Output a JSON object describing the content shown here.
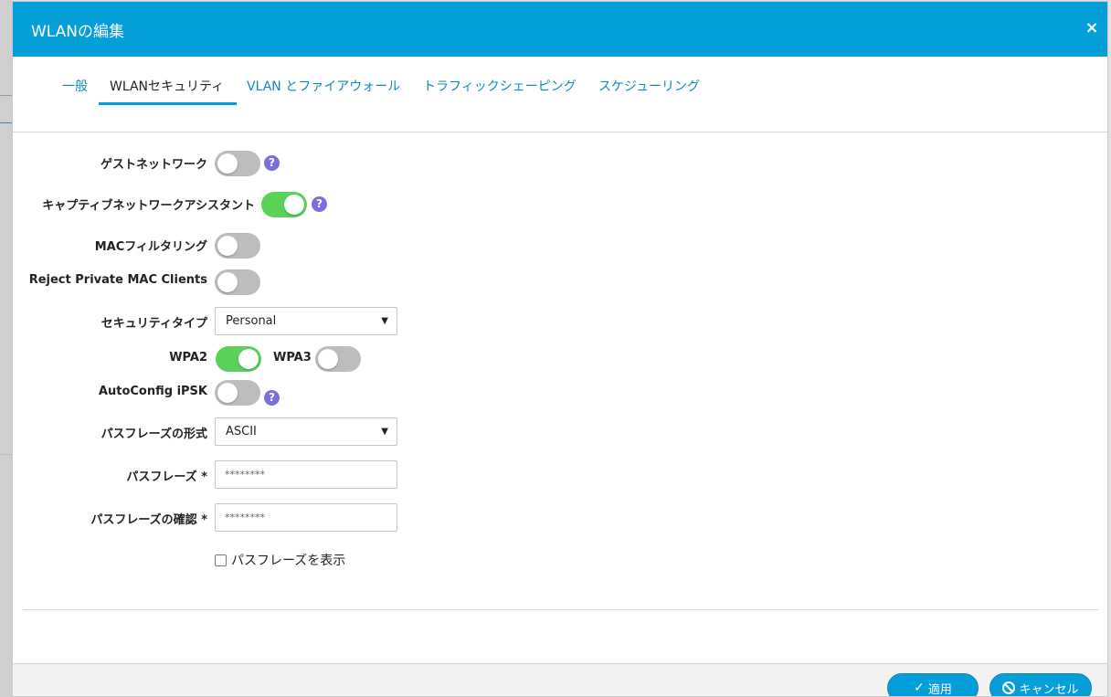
{
  "modal": {
    "title": "WLANの編集",
    "close_label": "×"
  },
  "tabs": [
    {
      "label": "一般"
    },
    {
      "label": "WLANセキュリティ"
    },
    {
      "label": "VLAN とファイアウォール"
    },
    {
      "label": "トラフィックシェーピング"
    },
    {
      "label": "スケジューリング"
    }
  ],
  "active_tab": "WLANセキュリティ",
  "form": {
    "guest_network": {
      "label": "ゲストネットワーク",
      "enabled": false
    },
    "captive_assistant": {
      "label": "キャプティブネットワークアシスタント",
      "enabled": true
    },
    "mac_filtering": {
      "label": "MACフィルタリング",
      "enabled": false
    },
    "reject_private_mac": {
      "label": "Reject Private MAC Clients",
      "enabled": false
    },
    "security_type": {
      "label": "セキュリティタイプ",
      "value": "Personal"
    },
    "wpa2": {
      "label": "WPA2",
      "enabled": true
    },
    "wpa3": {
      "label": "WPA3",
      "enabled": false
    },
    "autoconfig_ipsk": {
      "label": "AutoConfig iPSK",
      "enabled": false
    },
    "passphrase_format": {
      "label": "パスフレーズの形式",
      "value": "ASCII"
    },
    "passphrase": {
      "label": "パスフレーズ *",
      "value": "********"
    },
    "passphrase_confirm": {
      "label": "パスフレーズの確認 *",
      "value": "********"
    },
    "show_passphrase": {
      "label": "パスフレーズを表示",
      "checked": false
    }
  },
  "help_icon_glyph": "?",
  "caret_glyph": "▼",
  "footer": {
    "apply_label": "適用",
    "cancel_label": "キャンセル"
  },
  "colors": {
    "header": "#049fd9",
    "toggle_on": "#5ad25a",
    "toggle_off": "#bdbdbd",
    "help_icon": "#7b6fe0",
    "tab_link": "#0d8ac0"
  }
}
